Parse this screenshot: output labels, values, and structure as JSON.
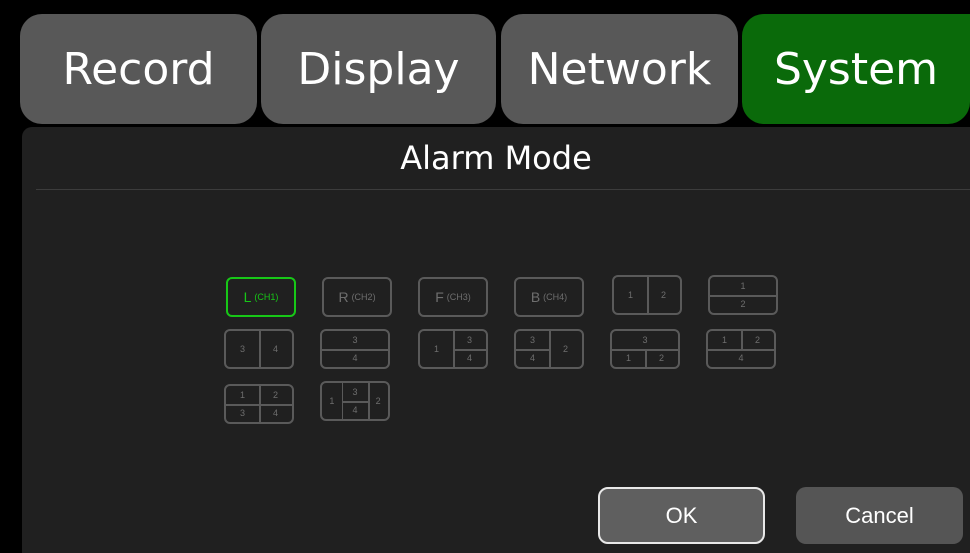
{
  "tabs": {
    "record": "Record",
    "display": "Display",
    "network": "Network",
    "system": "System"
  },
  "panel": {
    "title": "Alarm Mode"
  },
  "layouts": {
    "l": {
      "main": "L",
      "sub": "(CH1)"
    },
    "r": {
      "main": "R",
      "sub": "(CH2)"
    },
    "f": {
      "main": "F",
      "sub": "(CH3)"
    },
    "b": {
      "main": "B",
      "sub": "(CH4)"
    },
    "n1": "1",
    "n2": "2",
    "n3": "3",
    "n4": "4"
  },
  "buttons": {
    "ok": "OK",
    "cancel": "Cancel"
  },
  "colors": {
    "active_tab": "#0a6a0a",
    "selected": "#17c717"
  }
}
